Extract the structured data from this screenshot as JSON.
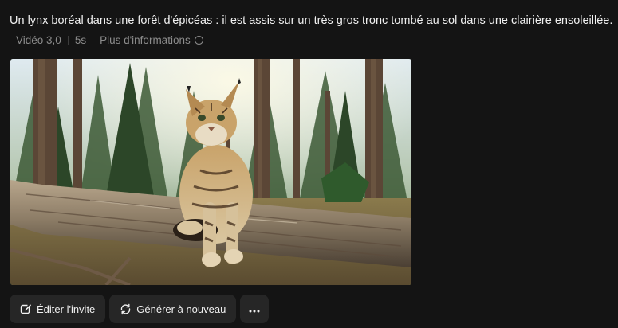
{
  "prompt": {
    "text": "Un lynx boréal dans une forêt d'épicéas : il est assis sur un très gros tronc tombé au sol dans une clairière ensoleillée."
  },
  "meta": {
    "model": "Vidéo 3,0",
    "duration": "5s",
    "more_info": "Plus d'informations"
  },
  "video": {
    "thumbnail_icon": "lynx-on-log-thumbnail"
  },
  "actions": {
    "edit_label": "Éditer l'invite",
    "regenerate_label": "Générer à nouveau",
    "more_icon": "more-horizontal-icon"
  },
  "colors": {
    "background": "#141414",
    "button": "#262626",
    "muted_text": "#8c8c8c",
    "text": "#f0f0f0"
  }
}
